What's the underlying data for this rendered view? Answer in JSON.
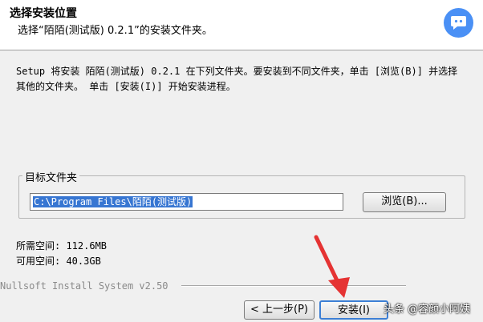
{
  "header": {
    "title": "选择安装位置",
    "subtitle": "选择“陌陌(测试版) 0.2.1”的安装文件夹。"
  },
  "description": "Setup 将安装 陌陌(测试版) 0.2.1 在下列文件夹。要安装到不同文件夹，单击 [浏览(B)] 并选择其他的文件夹。 单击 [安装(I)] 开始安装进程。",
  "destination": {
    "group_label": "目标文件夹",
    "path": "C:\\Program Files\\陌陌(测试版)",
    "browse_label": "浏览(B)..."
  },
  "space": {
    "required": "所需空间: 112.6MB",
    "available": "可用空间: 40.3GB"
  },
  "footer": {
    "branding": "Nullsoft Install System v2.50",
    "back_label": "< 上一步(P)",
    "install_label": "安装(I)"
  },
  "watermark": "头条 @容颜小阿姨",
  "colors": {
    "logo": "#4a90f5",
    "selection": "#3776d2",
    "arrow": "#e53333"
  },
  "icons": {
    "logo": "momo-app-logo",
    "annotation": "red-arrow"
  }
}
